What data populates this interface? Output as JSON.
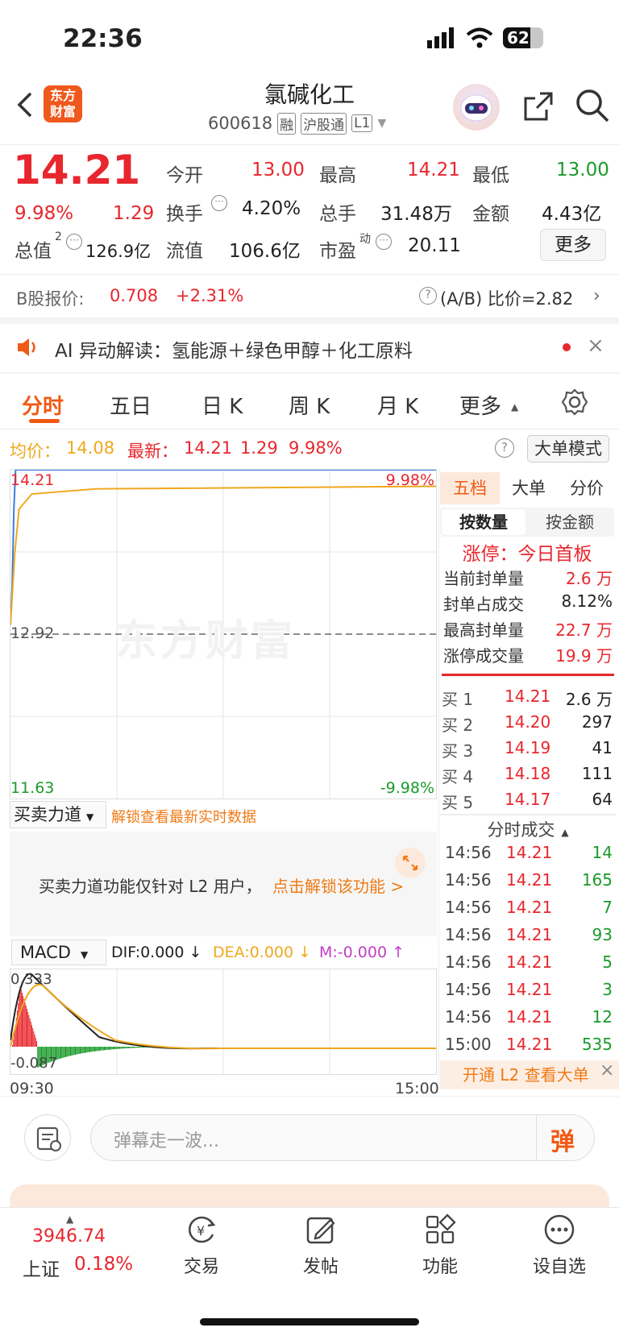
{
  "status": {
    "time": "22:36",
    "battery": "62"
  },
  "header": {
    "title": "氯碱化工",
    "code": "600618",
    "tags": [
      "融",
      "沪股通",
      "L1"
    ],
    "logo_line1": "东方",
    "logo_line2": "财富"
  },
  "quote": {
    "price": "14.21",
    "pct": "9.98%",
    "change": "1.29",
    "open_label": "今开",
    "open": "13.00",
    "high_label": "最高",
    "high": "14.21",
    "low_label": "最低",
    "low": "13.00",
    "turnover_label": "换手",
    "turnover": "4.20%",
    "volume_label": "总手",
    "volume": "31.48万",
    "amount_label": "金额",
    "amount": "4.43亿",
    "mktcap_label": "总值",
    "mktcap_sup": "2",
    "mktcap": "126.9亿",
    "float_label": "流值",
    "float": "106.6亿",
    "pe_label": "市盈",
    "pe_sup": "动",
    "pe": "20.11",
    "more_label": "更多"
  },
  "bshare": {
    "label": "B股报价:",
    "price": "0.708",
    "pct": "+2.31%",
    "ratio": "(A/B) 比价=2.82"
  },
  "ai": {
    "text": "AI 异动解读：氢能源＋绿色甲醇＋化工原料"
  },
  "tabs": [
    "分时",
    "五日",
    "日 K",
    "周 K",
    "月 K",
    "更多"
  ],
  "chart_info": {
    "avg_label": "均价：",
    "avg": "14.08",
    "latest_label": "最新：",
    "latest": "14.21",
    "chg": "1.29",
    "pct": "9.98%",
    "mode_btn": "大单模式"
  },
  "chart_data": {
    "type": "line",
    "x_start": "09:30",
    "x_end": "15:00",
    "ylim": [
      11.63,
      14.21
    ],
    "prev_close": "12.92",
    "y_top_label": "14.21",
    "y_mid_label": "12.92",
    "y_bottom_label": "11.63",
    "pct_top_label": "9.98%",
    "pct_bottom_label": "-9.98%",
    "series": [
      {
        "name": "price",
        "color": "#3a7be0",
        "values": [
          [
            0,
            13.0
          ],
          [
            0.004,
            13.3
          ],
          [
            0.008,
            13.9
          ],
          [
            0.012,
            14.21
          ],
          [
            1,
            14.21
          ]
        ]
      },
      {
        "name": "avg",
        "color": "#f0a81e",
        "values": [
          [
            0,
            12.99
          ],
          [
            0.01,
            13.55
          ],
          [
            0.02,
            13.9
          ],
          [
            0.05,
            14.02
          ],
          [
            0.2,
            14.06
          ],
          [
            1,
            14.08
          ]
        ]
      }
    ]
  },
  "watermark": "东方财富",
  "force": {
    "label": "买卖力道",
    "unlock_link": "解锁查看最新实时数据",
    "notice": "买卖力道功能仅针对 L2 用户，",
    "notice_link": "点击解锁该功能 >"
  },
  "macd": {
    "label": "MACD",
    "dif": "DIF:0.000 ↓",
    "dea": "DEA:0.000 ↓",
    "m": "M:-0.000 ↑",
    "top": "0.333",
    "bottom": "-0.087",
    "xstart": "09:30",
    "xend": "15:00"
  },
  "side": {
    "tabs": [
      "五档",
      "大单",
      "分价"
    ],
    "subtabs": [
      "按数量",
      "按金额"
    ],
    "limit_title": "涨停：今日首板",
    "limit_rows": [
      [
        "当前封单量",
        "2.6 万"
      ],
      [
        "封单占成交",
        "8.12%"
      ],
      [
        "最高封单量",
        "22.7 万"
      ],
      [
        "涨停成交量",
        "19.9 万"
      ]
    ],
    "bids": [
      [
        "买 1",
        "14.21",
        "2.6 万"
      ],
      [
        "买 2",
        "14.20",
        "297"
      ],
      [
        "买 3",
        "14.19",
        "41"
      ],
      [
        "买 4",
        "14.18",
        "111"
      ],
      [
        "买 5",
        "14.17",
        "64"
      ]
    ],
    "ticks_title": "分时成交",
    "ticks": [
      [
        "14:56",
        "14.21",
        "14"
      ],
      [
        "14:56",
        "14.21",
        "165"
      ],
      [
        "14:56",
        "14.21",
        "7"
      ],
      [
        "14:56",
        "14.21",
        "93"
      ],
      [
        "14:56",
        "14.21",
        "5"
      ],
      [
        "14:56",
        "14.21",
        "3"
      ],
      [
        "14:56",
        "14.21",
        "12"
      ],
      [
        "15:00",
        "14.21",
        "535"
      ]
    ],
    "l2_btn": "开通 L2 查看大单"
  },
  "comment": {
    "placeholder": "弹幕走一波...",
    "send": "弹"
  },
  "bottom": {
    "index_value": "3946.74",
    "index_name": "上证",
    "index_pct": "0.18%",
    "items": [
      "交易",
      "发帖",
      "功能",
      "设自选"
    ]
  }
}
